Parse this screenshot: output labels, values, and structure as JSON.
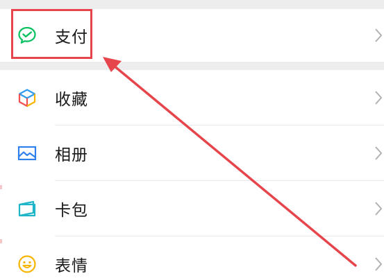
{
  "menu": {
    "pay": {
      "label": "支付",
      "icon": "wechat-pay-icon"
    },
    "items": [
      {
        "label": "收藏",
        "icon": "favorites-cube-icon"
      },
      {
        "label": "相册",
        "icon": "album-picture-icon"
      },
      {
        "label": "卡包",
        "icon": "card-wallet-icon"
      },
      {
        "label": "表情",
        "icon": "sticker-smile-icon"
      }
    ]
  },
  "annotation": {
    "highlight_color": "#e5454b",
    "target": "支付"
  },
  "colors": {
    "background": "#ededed",
    "row": "#ffffff",
    "text": "#191919",
    "pay_green": "#07c160"
  }
}
